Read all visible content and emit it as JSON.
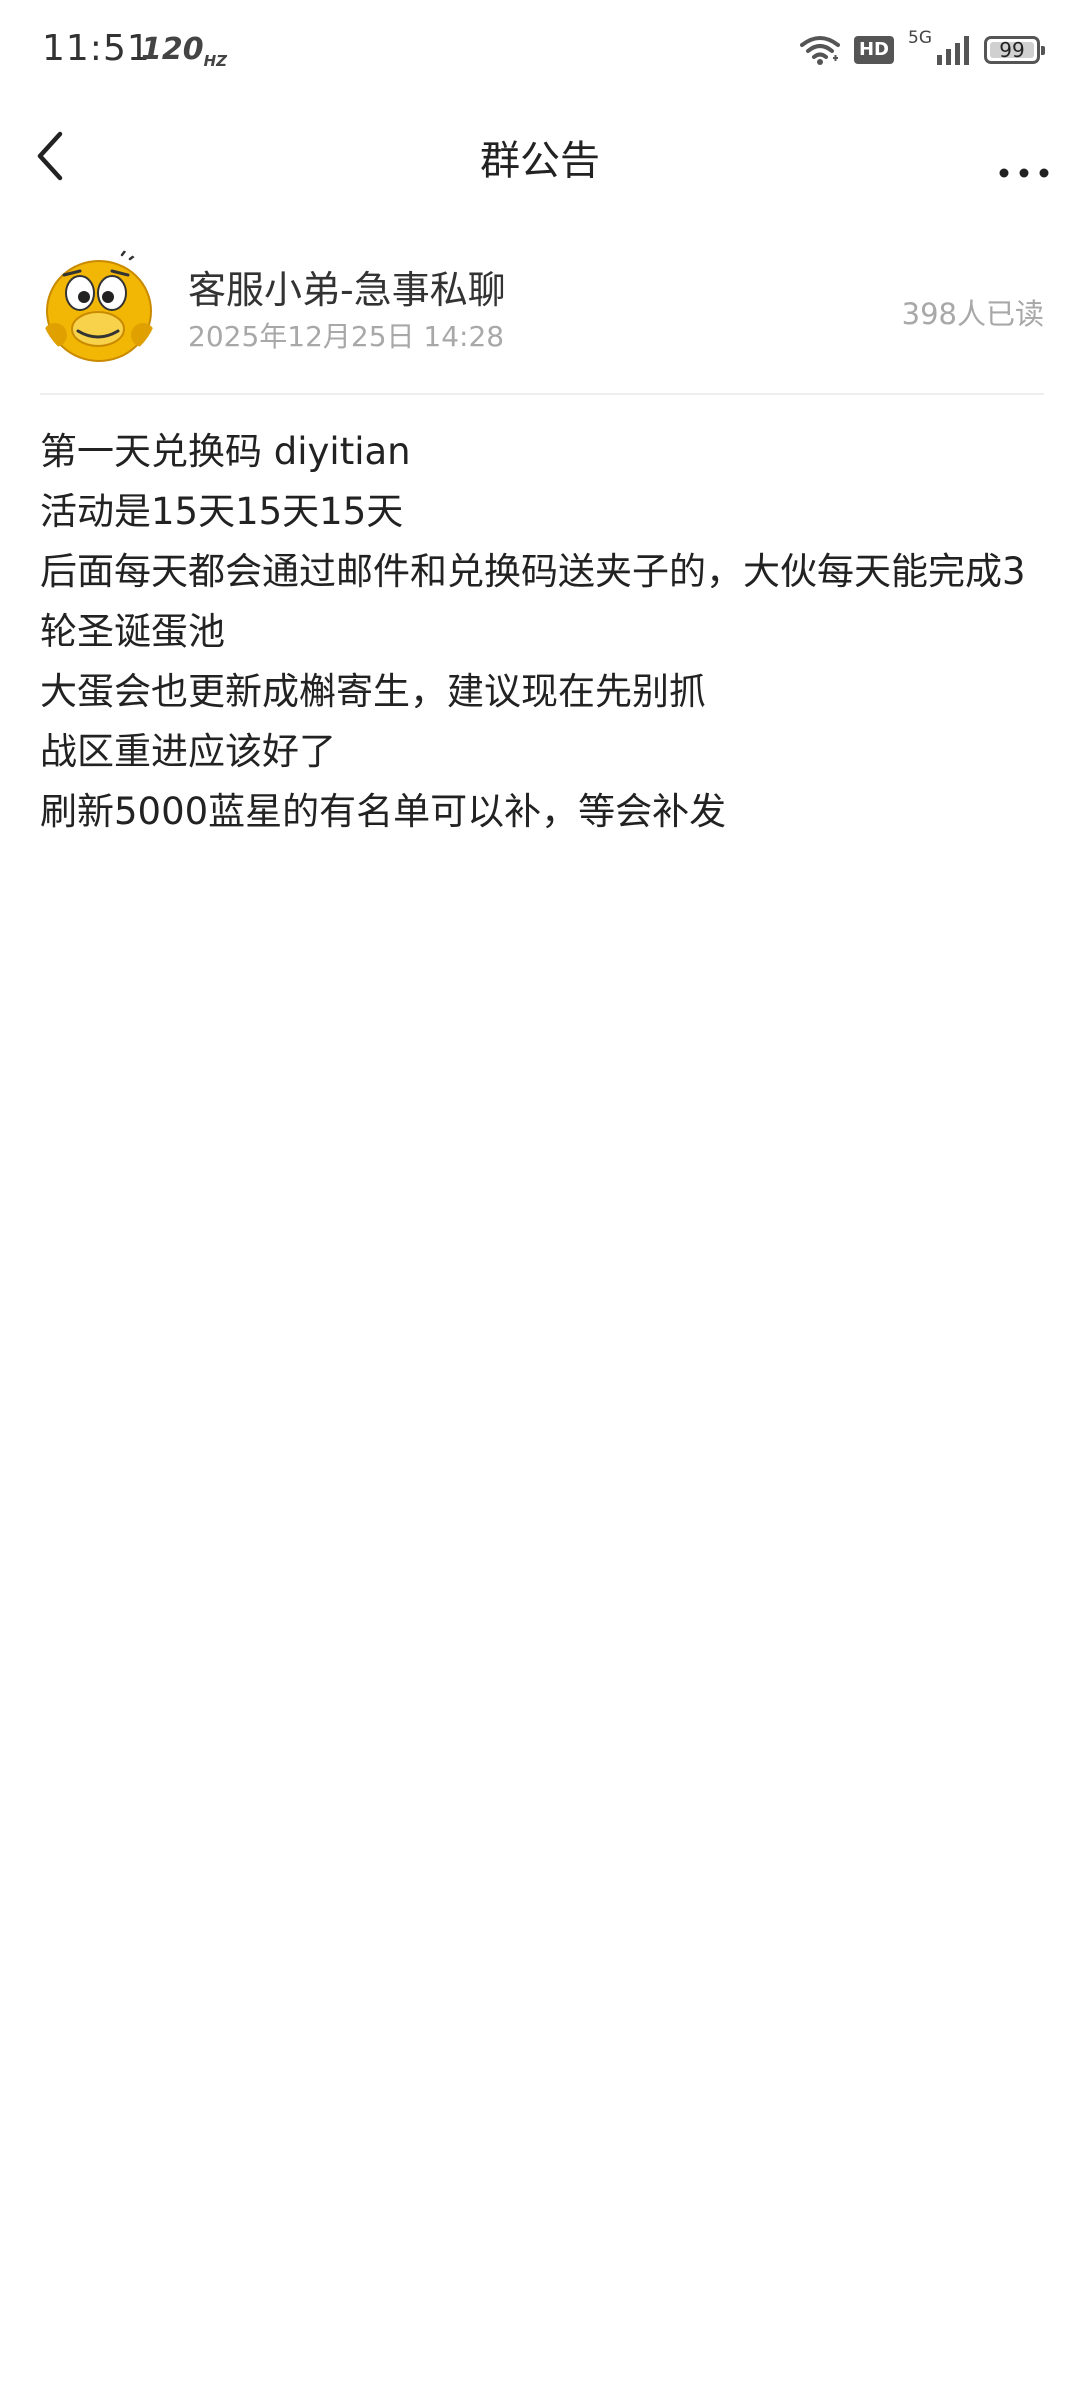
{
  "status_bar": {
    "time": "11:51",
    "refresh_rate": "120",
    "refresh_unit": "HZ",
    "hd_badge": "HD",
    "network": "5G",
    "battery": "99"
  },
  "nav": {
    "title": "群公告"
  },
  "announcement": {
    "author_name": "客服小弟-急事私聊",
    "timestamp": "2025年12月25日 14:28",
    "read_count": "398人已读",
    "lines": [
      "第一天兑换码 diyitian",
      "活动是15天15天15天",
      "后面每天都会通过邮件和兑换码送夹子的，大伙每天能完成3轮圣诞蛋池",
      "大蛋会也更新成槲寄生，建议现在先别抓",
      "战区重进应该好了",
      "刷新5000蓝星的有名单可以补，等会补发"
    ]
  },
  "colors": {
    "background": "#ffffff",
    "primary_text": "#222222",
    "secondary_text": "#a8a8a8",
    "avatar_yellow": "#f2b705"
  },
  "icons": {
    "back": "chevron-left-icon",
    "more": "more-dots-icon",
    "wifi": "wifi-icon",
    "signal": "signal-bars-icon",
    "battery": "battery-icon"
  }
}
